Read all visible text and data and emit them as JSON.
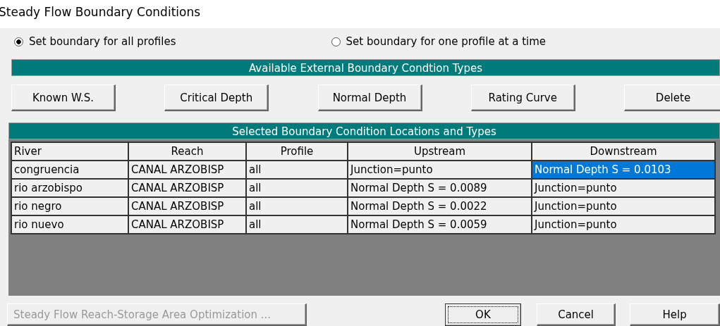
{
  "window": {
    "title": "Steady Flow Boundary Conditions"
  },
  "mode_options": [
    {
      "label": "Set boundary for all profiles",
      "selected": true
    },
    {
      "label": "Set boundary for one profile at a time",
      "selected": false
    }
  ],
  "types_header": "Available External Boundary Condtion Types",
  "type_buttons": [
    "Known W.S.",
    "Critical Depth",
    "Normal Depth",
    "Rating Curve",
    "Delete"
  ],
  "table": {
    "title": "Selected Boundary Condition Locations and Types",
    "columns": [
      "River",
      "Reach",
      "Profile",
      "Upstream",
      "Downstream"
    ],
    "rows": [
      {
        "cells": [
          {
            "text": "congruencia",
            "selected": false
          },
          {
            "text": "CANAL ARZOBISP",
            "selected": false
          },
          {
            "text": "all",
            "selected": false
          },
          {
            "text": "Junction=punto",
            "selected": false
          },
          {
            "text": "Normal Depth S = 0.0103",
            "selected": true
          }
        ]
      },
      {
        "cells": [
          {
            "text": "rio arzobispo",
            "selected": false
          },
          {
            "text": "CANAL ARZOBISP",
            "selected": false
          },
          {
            "text": "all",
            "selected": false
          },
          {
            "text": "Normal Depth S = 0.0089",
            "selected": false
          },
          {
            "text": "Junction=punto",
            "selected": false
          }
        ]
      },
      {
        "cells": [
          {
            "text": "rio negro",
            "selected": false
          },
          {
            "text": "CANAL ARZOBISP",
            "selected": false
          },
          {
            "text": "all",
            "selected": false
          },
          {
            "text": "Normal Depth S = 0.0022",
            "selected": false
          },
          {
            "text": "Junction=punto",
            "selected": false
          }
        ]
      },
      {
        "cells": [
          {
            "text": "rio nuevo",
            "selected": false
          },
          {
            "text": "CANAL ARZOBISP",
            "selected": false
          },
          {
            "text": "all",
            "selected": false
          },
          {
            "text": "Normal Depth S = 0.0059",
            "selected": false
          },
          {
            "text": "Junction=punto",
            "selected": false
          }
        ]
      }
    ]
  },
  "footer_buttons": [
    {
      "label": "Steady Flow Reach-Storage Area Optimization ...",
      "disabled": true,
      "default": false
    },
    {
      "label": "OK",
      "disabled": false,
      "default": true
    },
    {
      "label": "Cancel",
      "disabled": false,
      "default": false
    },
    {
      "label": "Help",
      "disabled": false,
      "default": false
    }
  ]
}
